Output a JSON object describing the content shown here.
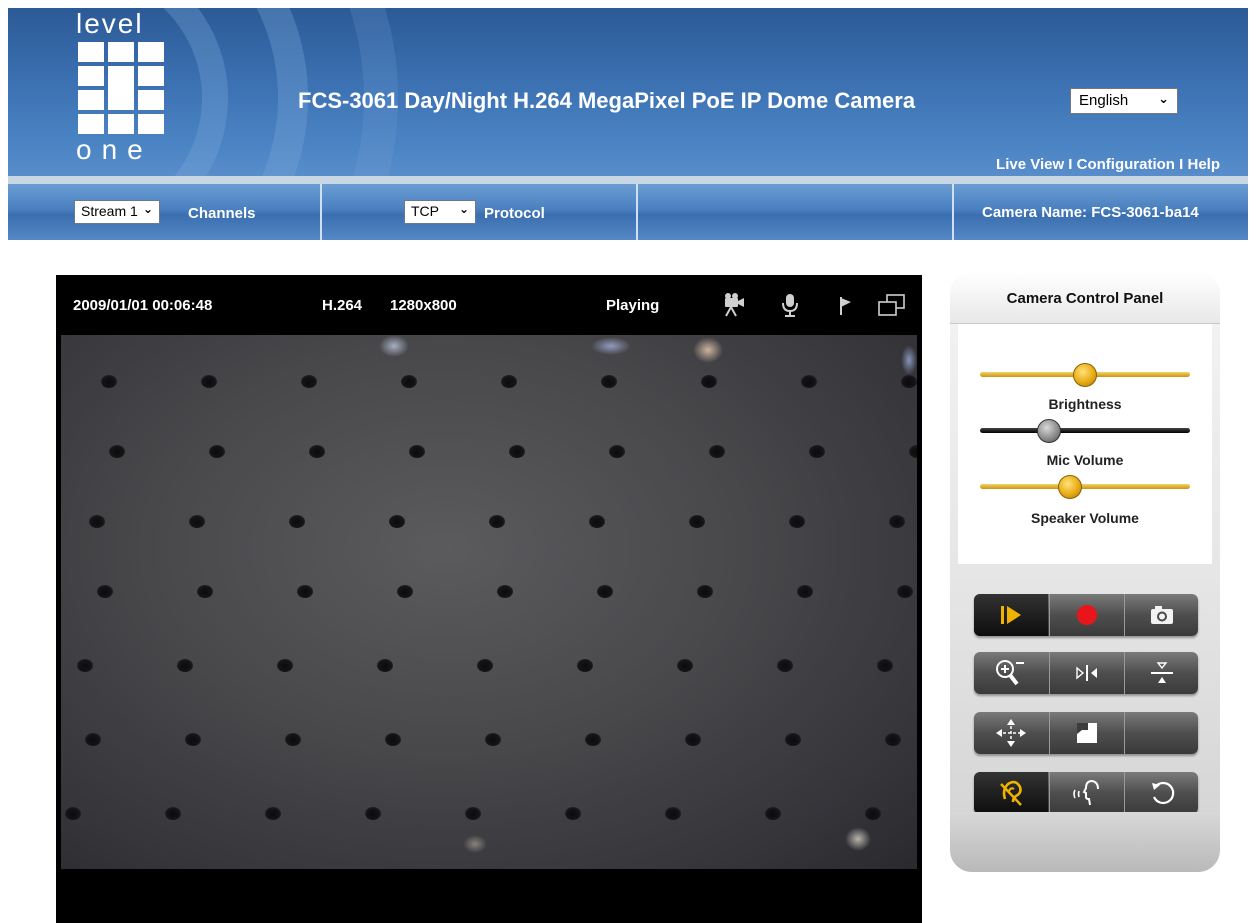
{
  "header": {
    "logo_top": "level",
    "logo_bottom": "one",
    "title": "FCS-3061   Day/Night H.264 MegaPixel PoE IP Dome Camera",
    "language": "English",
    "nav": {
      "live_view": "Live View",
      "sep1": " I ",
      "configuration": "Configuration",
      "sep2": " I ",
      "help": "Help"
    },
    "accent_color": "#3a6fb0"
  },
  "toolbar": {
    "stream_select": "Stream 1",
    "channels_label": "Channels",
    "protocol_select": "TCP",
    "protocol_label": "Protocol",
    "camera_name": "Camera Name: FCS-3061-ba14"
  },
  "video": {
    "datetime": "2009/01/01  00:06:48",
    "codec": "H.264",
    "resolution": "1280x800",
    "status": "Playing",
    "icons": [
      "video-camera-icon",
      "microphone-icon",
      "flag-icon",
      "window-icon"
    ]
  },
  "panel": {
    "title": "Camera Control Panel",
    "sliders": [
      {
        "label": "Brightness",
        "value": 0.5,
        "color": "#e0b020"
      },
      {
        "label": "Mic Volume",
        "value": 0.33,
        "color": "#111111"
      },
      {
        "label": "Speaker Volume",
        "value": 0.43,
        "color": "#e0b020"
      }
    ],
    "buttons": [
      [
        "play-icon",
        "record-icon",
        "snapshot-icon"
      ],
      [
        "zoom-icon",
        "mirror-icon",
        "flip-icon"
      ],
      [
        "move-arrows-icon",
        "crop-icon",
        "blank"
      ],
      [
        "listen-icon",
        "talk-icon",
        "rotate-icon"
      ]
    ]
  }
}
